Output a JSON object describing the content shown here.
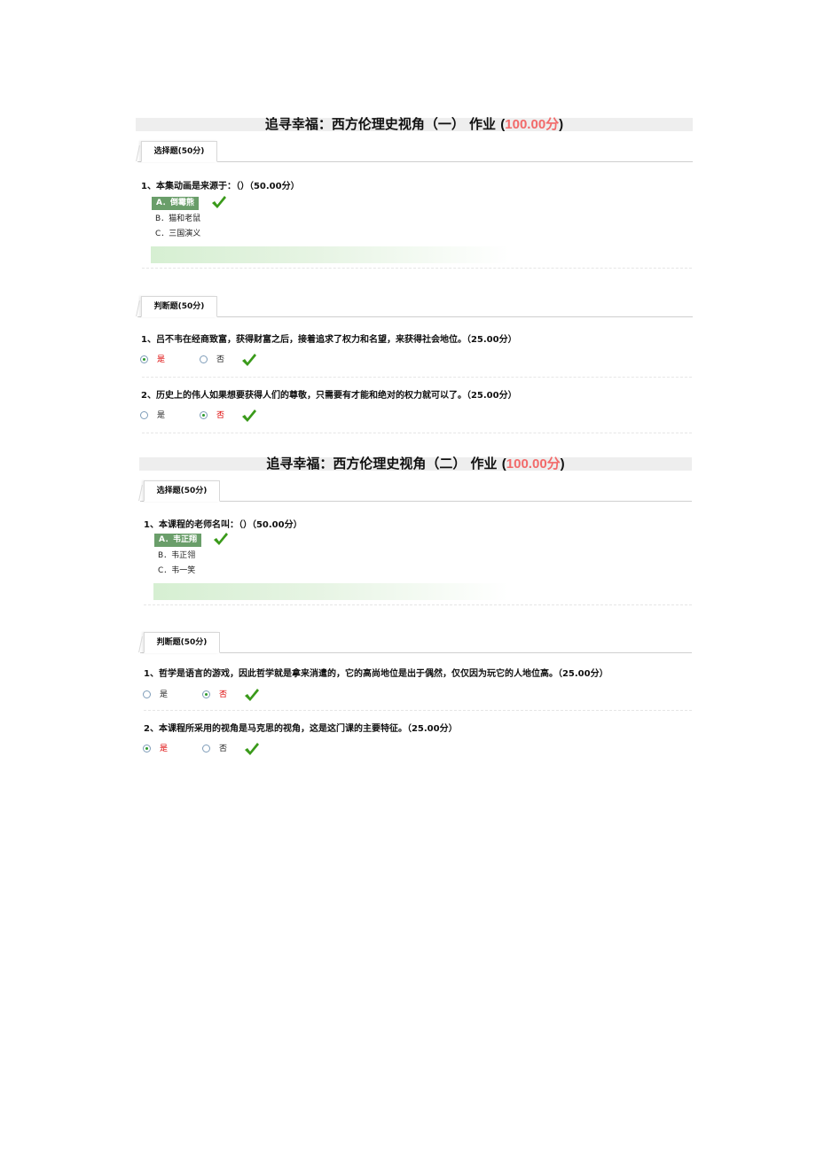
{
  "homeworks": [
    {
      "title": "追寻幸福：西方伦理史视角（一） 作业",
      "score": "100.00分",
      "choice_section": {
        "tab_label": "选择题(50分)",
        "questions": [
          {
            "text": "1、本集动画是来源于：（）（50.00分）",
            "options": [
              "A．倒霉熊",
              "B．猫和老鼠",
              "C．三国演义"
            ],
            "selected_index": 0,
            "result": "correct"
          }
        ]
      },
      "judge_section": {
        "tab_label": "判断题(50分)",
        "questions": [
          {
            "text": "1、吕不韦在经商致富，获得财富之后，接着追求了权力和名望，来获得社会地位。（25.00分）",
            "options": [
              "是",
              "否"
            ],
            "selected_index": 0,
            "result": "correct"
          },
          {
            "text": "2、历史上的伟人如果想要获得人们的尊敬，只需要有才能和绝对的权力就可以了。（25.00分）",
            "options": [
              "是",
              "否"
            ],
            "selected_index": 1,
            "result": "correct"
          }
        ]
      }
    },
    {
      "title": "追寻幸福：西方伦理史视角（二） 作业",
      "score": "100.00分",
      "choice_section": {
        "tab_label": "选择题(50分)",
        "questions": [
          {
            "text": "1、本课程的老师名叫：（）（50.00分）",
            "options": [
              "A．韦正翔",
              "B．韦正翎",
              "C．韦一笑"
            ],
            "selected_index": 0,
            "result": "correct"
          }
        ]
      },
      "judge_section": {
        "tab_label": "判断题(50分)",
        "questions": [
          {
            "text": "1、哲学是语言的游戏，因此哲学就是拿来消遣的，它的高尚地位是出于偶然，仅仅因为玩它的人地位高。（25.00分）",
            "options": [
              "是",
              "否"
            ],
            "selected_index": 1,
            "result": "correct"
          },
          {
            "text": "2、本课程所采用的视角是马克思的视角，这是这门课的主要特征。（25.00分）",
            "options": [
              "是",
              "否"
            ],
            "selected_index": 0,
            "result": "correct"
          }
        ]
      }
    }
  ],
  "punct": {
    "open": "(",
    "close": ")"
  },
  "icons": {
    "check": "check-icon",
    "radio": "radio-icon"
  },
  "colors": {
    "score": "#f26a6a",
    "correct_bg": "#6a9e6a",
    "check": "#3a9a1a",
    "selected_label": "#dd0000"
  }
}
